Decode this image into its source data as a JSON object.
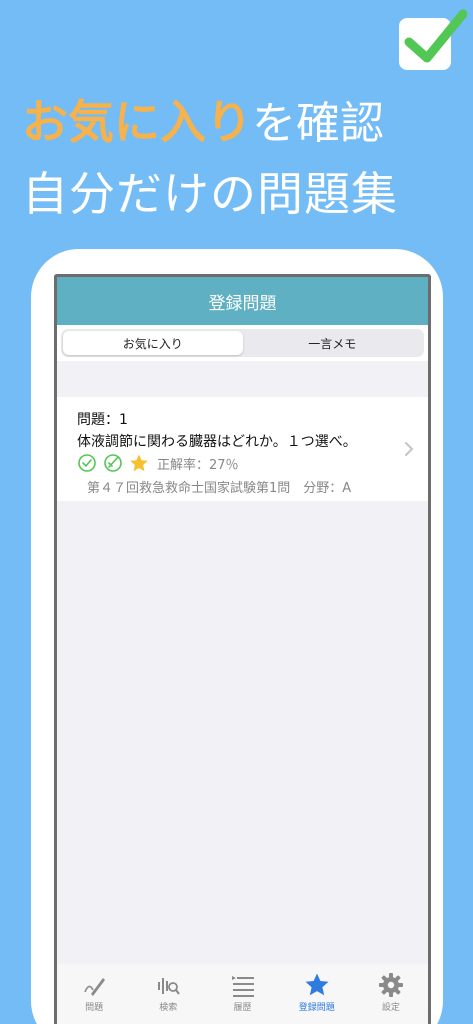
{
  "promo": {
    "headline_accent": "お気に入り",
    "headline_rest": "を確認",
    "subheadline": "自分だけの問題集"
  },
  "app": {
    "nav_title": "登録問題",
    "segments": [
      {
        "label": "お気に入り",
        "selected": true
      },
      {
        "label": "一言メモ",
        "selected": false
      }
    ],
    "questions": [
      {
        "number_label": "問題：1",
        "text": "体液調節に関わる臓器はどれか。１つ選べ。",
        "correct_rate": "正解率：27％",
        "source": "第４７回救急救命士国家試験第1問　分野：A"
      }
    ],
    "tabs": [
      {
        "label": "問題",
        "icon": "pencil-icon",
        "active": false
      },
      {
        "label": "検索",
        "icon": "search-icon",
        "active": false
      },
      {
        "label": "履歴",
        "icon": "list-icon",
        "active": false
      },
      {
        "label": "登録問題",
        "icon": "star-icon",
        "active": true
      },
      {
        "label": "設定",
        "icon": "gear-icon",
        "active": false
      }
    ]
  },
  "colors": {
    "background": "#74bcf6",
    "accent_orange": "#f7b24b",
    "nav_teal": "#5fb0c3",
    "check_green": "#52c755",
    "star_yellow": "#f5c130",
    "active_tab_blue": "#2f7be0"
  }
}
